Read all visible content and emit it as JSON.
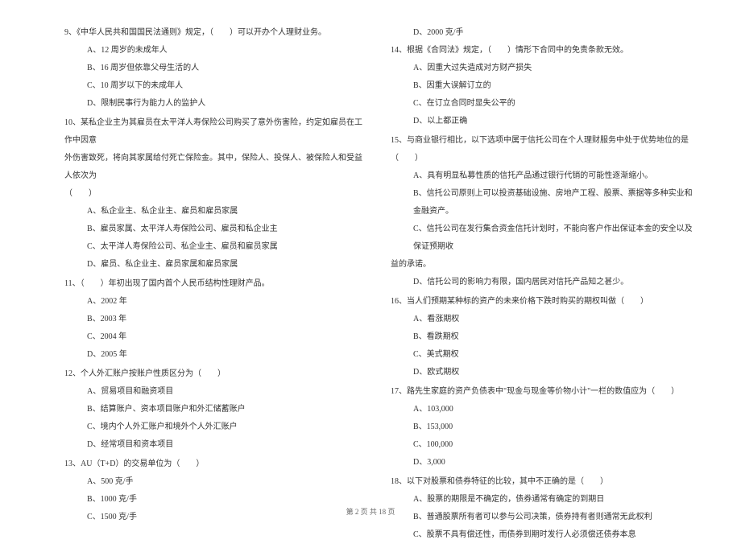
{
  "left": {
    "q9": {
      "text": "9、《中华人民共和国国民法通则》规定，（　　）可以开办个人理财业务。",
      "a": "A、12 周岁的未成年人",
      "b": "B、16 周岁但依靠父母生活的人",
      "c": "C、10 周岁以下的未成年人",
      "d": "D、限制民事行为能力人的监护人"
    },
    "q10": {
      "text1": "10、某私企业主为其雇员在太平洋人寿保险公司购买了意外伤害险，约定如雇员在工作中因意",
      "text2": "外伤害致死，将向其家属给付死亡保险金。其中，保险人、投保人、被保险人和受益人依次为",
      "text3": "（　　）",
      "a": "A、私企业主、私企业主、雇员和雇员家属",
      "b": "B、雇员家属、太平洋人寿保险公司、雇员和私企业主",
      "c": "C、太平洋人寿保险公司、私企业主、雇员和雇员家属",
      "d": "D、雇员、私企业主、雇员家属和雇员家属"
    },
    "q11": {
      "text": "11、（　　）年初出现了国内首个人民币结构性理财产品。",
      "a": "A、2002 年",
      "b": "B、2003 年",
      "c": "C、2004 年",
      "d": "D、2005 年"
    },
    "q12": {
      "text": "12、个人外汇账户按账户性质区分为（　　）",
      "a": "A、贸易项目和融资项目",
      "b": "B、结算账户、资本项目账户和外汇储蓄账户",
      "c": "C、境内个人外汇账户和境外个人外汇账户",
      "d": "D、经常项目和资本项目"
    },
    "q13": {
      "text": "13、AU（T+D）的交易单位为（　　）",
      "a": "A、500 克/手",
      "b": "B、1000 克/手",
      "c": "C、1500 克/手"
    }
  },
  "right": {
    "q13d": "D、2000 克/手",
    "q14": {
      "text": "14、根据《合同法》规定，（　　）情形下合同中的免责条款无效。",
      "a": "A、因重大过失造成对方财产损失",
      "b": "B、因重大误解订立的",
      "c": "C、在订立合同时显失公平的",
      "d": "D、以上都正确"
    },
    "q15": {
      "text": "15、与商业银行相比，以下选项中属于信托公司在个人理财服务中处于优势地位的是（　　）",
      "a": "A、具有明显私募性质的信托产品通过银行代销的可能性逐渐缩小。",
      "b": "B、信托公司原则上可以投资基础设施、房地产工程、股票、票据等多种实业和金融资产。",
      "c1": "C、信托公司在发行集合资金信托计划时，不能向客户作出保证本金的安全以及保证预期收",
      "c2": "益的承诺。",
      "d": "D、信托公司的影响力有限，国内居民对信托产品知之甚少。"
    },
    "q16": {
      "text": "16、当人们预期某种标的资产的未来价格下跌时购买的期权叫做（　　）",
      "a": "A、看涨期权",
      "b": "B、看跌期权",
      "c": "C、美式期权",
      "d": "D、欧式期权"
    },
    "q17": {
      "text": "17、路先生家庭的资产负债表中\"现金与现金等价物小计\"一栏的数值应为（　　）",
      "a": "A、103,000",
      "b": "B、153,000",
      "c": "C、100,000",
      "d": "D、3,000"
    },
    "q18": {
      "text": "18、以下对股票和债券特征的比较，其中不正确的是（　　）",
      "a": "A、股票的期限是不确定的，债券通常有确定的到期日",
      "b": "B、普通股票所有者可以参与公司决策，债券持有者则通常无此权利",
      "c": "C、股票不具有偿还性，而债券到期时发行人必须偿还债券本息"
    }
  },
  "footer": "第 2 页 共 18 页"
}
